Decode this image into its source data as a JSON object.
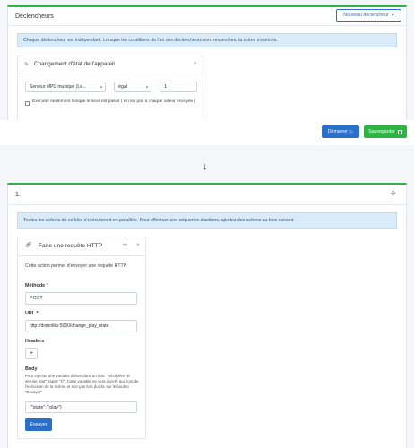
{
  "triggers": {
    "title": "Déclencheurs",
    "new_trigger_label": "Nouveau déclencheur",
    "info": "Chaque déclencheur est indépendant. Lorsque les conditions de l'un ces déclencheurs sont respectées, la scène s'exécute.",
    "device_card": {
      "title": "Changement d'état de l'appareil",
      "device_select": "Serveur MPD musique (Le...",
      "operator_select": "égal",
      "value": "1",
      "checkbox_label": "Exécuter seulement lorsque le seuil est passé ( et non pas à chaque valeur envoyée )"
    }
  },
  "actions_bar": {
    "start_label": "Démarrer",
    "save_label": "Sauvegarder"
  },
  "arrow": "↓",
  "block": {
    "title": "1.",
    "info": "Toutes les actions de ce bloc s'exécuteront en parallèle. Pour effectuer une séquence d'actions, ajoutez des actions au bloc suivant.",
    "http_card": {
      "title": "Faire une requête HTTP",
      "description": "Cette action permet d'envoyer une requête HTTP.",
      "method_label": "Méthode *",
      "method_value": "POST",
      "url_label": "URL *",
      "url_value": "http://domotiks:5000/change_play_state",
      "headers_label": "Headers",
      "add_symbol": "+",
      "body_label": "Body",
      "body_help": "Pour injecter une variable dérivé dans un bloc \"Récupérer le dernier état\", tapez \"{{\". Cette variable ne sera injecté que lors de l'exécution de la scène, et non pas lors du clic sur le bouton \"Essayer\"",
      "body_value": "{\"state\": \"play\"}",
      "try_label": "Essayer"
    }
  },
  "colors": {
    "green": "#2fb344",
    "blue": "#2a6fc9",
    "alert_bg": "#d9ebf9"
  },
  "icons": {
    "plus": "plus-icon",
    "play": "play-icon",
    "save": "save-icon",
    "activity": "activity-icon",
    "close": "close-icon",
    "move": "move-icon",
    "link": "link-icon",
    "arrow_down": "arrow-down-icon"
  }
}
